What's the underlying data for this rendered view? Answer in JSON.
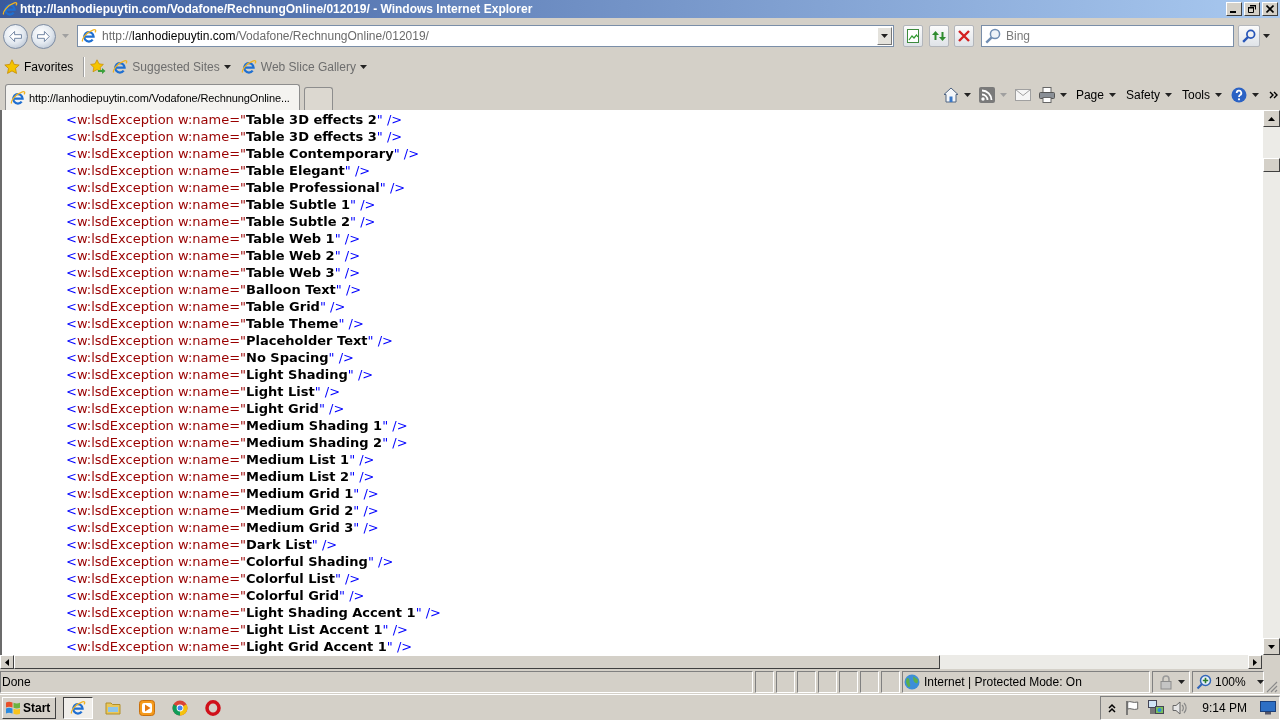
{
  "window": {
    "title": "http://lanhodiepuytin.com/Vodafone/RechnungOnline/012019/ - Windows Internet Explorer"
  },
  "address_bar": {
    "url_parts": [
      {
        "kind": "scheme",
        "text": "http://"
      },
      {
        "kind": "host",
        "text": "lanhodiepuytin.com"
      },
      {
        "kind": "path",
        "text": "/Vodafone/RechnungOnline/012019/"
      }
    ]
  },
  "search": {
    "placeholder": "Bing"
  },
  "favorites_bar": {
    "label": "Favorites",
    "links": [
      {
        "label": "Suggested Sites"
      },
      {
        "label": "Web Slice Gallery"
      }
    ]
  },
  "tabs": [
    {
      "label": "http://lanhodiepuytin.com/Vodafone/RechnungOnline...",
      "selected": true
    }
  ],
  "command_bar": {
    "menus": [
      {
        "label": "Page"
      },
      {
        "label": "Safety"
      },
      {
        "label": "Tools"
      }
    ]
  },
  "document": {
    "lines": [
      {
        "open": "<",
        "tag": "w:lsdException",
        "attribute": "w:name",
        "assign": "=\"",
        "value": "Table 3D effects 2",
        "close": "\" />"
      },
      {
        "open": "<",
        "tag": "w:lsdException",
        "attribute": "w:name",
        "assign": "=\"",
        "value": "Table 3D effects 3",
        "close": "\" />"
      },
      {
        "open": "<",
        "tag": "w:lsdException",
        "attribute": "w:name",
        "assign": "=\"",
        "value": "Table Contemporary",
        "close": "\" />"
      },
      {
        "open": "<",
        "tag": "w:lsdException",
        "attribute": "w:name",
        "assign": "=\"",
        "value": "Table Elegant",
        "close": "\" />"
      },
      {
        "open": "<",
        "tag": "w:lsdException",
        "attribute": "w:name",
        "assign": "=\"",
        "value": "Table Professional",
        "close": "\" />"
      },
      {
        "open": "<",
        "tag": "w:lsdException",
        "attribute": "w:name",
        "assign": "=\"",
        "value": "Table Subtle 1",
        "close": "\" />"
      },
      {
        "open": "<",
        "tag": "w:lsdException",
        "attribute": "w:name",
        "assign": "=\"",
        "value": "Table Subtle 2",
        "close": "\" />"
      },
      {
        "open": "<",
        "tag": "w:lsdException",
        "attribute": "w:name",
        "assign": "=\"",
        "value": "Table Web 1",
        "close": "\" />"
      },
      {
        "open": "<",
        "tag": "w:lsdException",
        "attribute": "w:name",
        "assign": "=\"",
        "value": "Table Web 2",
        "close": "\" />"
      },
      {
        "open": "<",
        "tag": "w:lsdException",
        "attribute": "w:name",
        "assign": "=\"",
        "value": "Table Web 3",
        "close": "\" />"
      },
      {
        "open": "<",
        "tag": "w:lsdException",
        "attribute": "w:name",
        "assign": "=\"",
        "value": "Balloon Text",
        "close": "\" />"
      },
      {
        "open": "<",
        "tag": "w:lsdException",
        "attribute": "w:name",
        "assign": "=\"",
        "value": "Table Grid",
        "close": "\" />"
      },
      {
        "open": "<",
        "tag": "w:lsdException",
        "attribute": "w:name",
        "assign": "=\"",
        "value": "Table Theme",
        "close": "\" />"
      },
      {
        "open": "<",
        "tag": "w:lsdException",
        "attribute": "w:name",
        "assign": "=\"",
        "value": "Placeholder Text",
        "close": "\" />"
      },
      {
        "open": "<",
        "tag": "w:lsdException",
        "attribute": "w:name",
        "assign": "=\"",
        "value": "No Spacing",
        "close": "\" />"
      },
      {
        "open": "<",
        "tag": "w:lsdException",
        "attribute": "w:name",
        "assign": "=\"",
        "value": "Light Shading",
        "close": "\" />"
      },
      {
        "open": "<",
        "tag": "w:lsdException",
        "attribute": "w:name",
        "assign": "=\"",
        "value": "Light List",
        "close": "\" />"
      },
      {
        "open": "<",
        "tag": "w:lsdException",
        "attribute": "w:name",
        "assign": "=\"",
        "value": "Light Grid",
        "close": "\" />"
      },
      {
        "open": "<",
        "tag": "w:lsdException",
        "attribute": "w:name",
        "assign": "=\"",
        "value": "Medium Shading 1",
        "close": "\" />"
      },
      {
        "open": "<",
        "tag": "w:lsdException",
        "attribute": "w:name",
        "assign": "=\"",
        "value": "Medium Shading 2",
        "close": "\" />"
      },
      {
        "open": "<",
        "tag": "w:lsdException",
        "attribute": "w:name",
        "assign": "=\"",
        "value": "Medium List 1",
        "close": "\" />"
      },
      {
        "open": "<",
        "tag": "w:lsdException",
        "attribute": "w:name",
        "assign": "=\"",
        "value": "Medium List 2",
        "close": "\" />"
      },
      {
        "open": "<",
        "tag": "w:lsdException",
        "attribute": "w:name",
        "assign": "=\"",
        "value": "Medium Grid 1",
        "close": "\" />"
      },
      {
        "open": "<",
        "tag": "w:lsdException",
        "attribute": "w:name",
        "assign": "=\"",
        "value": "Medium Grid 2",
        "close": "\" />"
      },
      {
        "open": "<",
        "tag": "w:lsdException",
        "attribute": "w:name",
        "assign": "=\"",
        "value": "Medium Grid 3",
        "close": "\" />"
      },
      {
        "open": "<",
        "tag": "w:lsdException",
        "attribute": "w:name",
        "assign": "=\"",
        "value": "Dark List",
        "close": "\" />"
      },
      {
        "open": "<",
        "tag": "w:lsdException",
        "attribute": "w:name",
        "assign": "=\"",
        "value": "Colorful Shading",
        "close": "\" />"
      },
      {
        "open": "<",
        "tag": "w:lsdException",
        "attribute": "w:name",
        "assign": "=\"",
        "value": "Colorful List",
        "close": "\" />"
      },
      {
        "open": "<",
        "tag": "w:lsdException",
        "attribute": "w:name",
        "assign": "=\"",
        "value": "Colorful Grid",
        "close": "\" />"
      },
      {
        "open": "<",
        "tag": "w:lsdException",
        "attribute": "w:name",
        "assign": "=\"",
        "value": "Light Shading Accent 1",
        "close": "\" />"
      },
      {
        "open": "<",
        "tag": "w:lsdException",
        "attribute": "w:name",
        "assign": "=\"",
        "value": "Light List Accent 1",
        "close": "\" />"
      },
      {
        "open": "<",
        "tag": "w:lsdException",
        "attribute": "w:name",
        "assign": "=\"",
        "value": "Light Grid Accent 1",
        "close": "\" />"
      }
    ]
  },
  "status_bar": {
    "text": "Done",
    "zone": "Internet | Protected Mode: On",
    "zoom": "100%"
  },
  "taskbar": {
    "start": "Start",
    "clock": "9:14 PM"
  }
}
